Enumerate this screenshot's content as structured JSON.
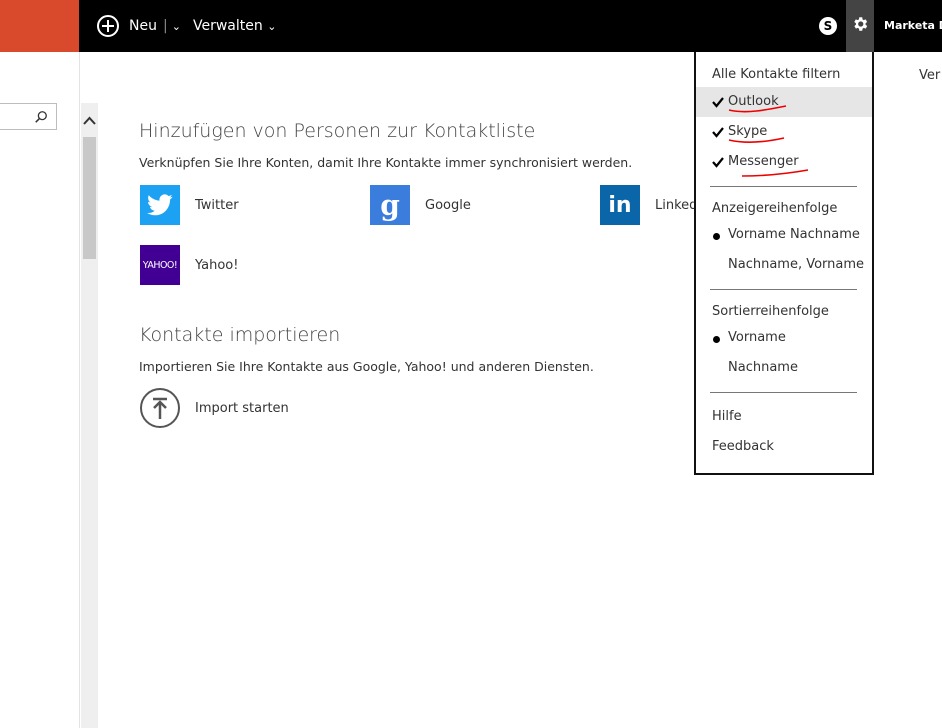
{
  "header": {
    "new_label": "Neu",
    "new_sep": "|",
    "manage_label": "Verwalten",
    "user_name": "Marketa De",
    "brand_color": "#d84a2b"
  },
  "search": {
    "placeholder": ""
  },
  "main": {
    "add_title": "Hinzufügen von Personen zur Kontaktliste",
    "add_desc": "Verknüpfen Sie Ihre Konten, damit Ihre Kontakte immer synchronisiert werden.",
    "services": [
      {
        "label": "Twitter",
        "icon": "twitter-icon"
      },
      {
        "label": "Google",
        "icon": "google-icon",
        "glyph": "g"
      },
      {
        "label": "Linked",
        "icon": "linkedin-icon",
        "glyph": "in"
      },
      {
        "label": "Yahoo!",
        "icon": "yahoo-icon",
        "glyph": "YAHOO!"
      }
    ],
    "import_title": "Kontakte importieren",
    "import_desc": "Importieren Sie Ihre Kontakte aus Google, Yahoo! und anderen Diensten.",
    "import_button": "Import starten",
    "right_stub": "Ver"
  },
  "dropdown": {
    "filter_header": "Alle Kontakte filtern",
    "filters": [
      {
        "label": "Outlook",
        "checked": true
      },
      {
        "label": "Skype",
        "checked": true
      },
      {
        "label": "Messenger",
        "checked": true
      }
    ],
    "display_header": "Anzeigereihenfolge",
    "display_options": [
      {
        "label": "Vorname Nachname",
        "selected": true
      },
      {
        "label": "Nachname, Vorname",
        "selected": false
      }
    ],
    "sort_header": "Sortierreihenfolge",
    "sort_options": [
      {
        "label": "Vorname",
        "selected": true
      },
      {
        "label": "Nachname",
        "selected": false
      }
    ],
    "help": "Hilfe",
    "feedback": "Feedback"
  }
}
